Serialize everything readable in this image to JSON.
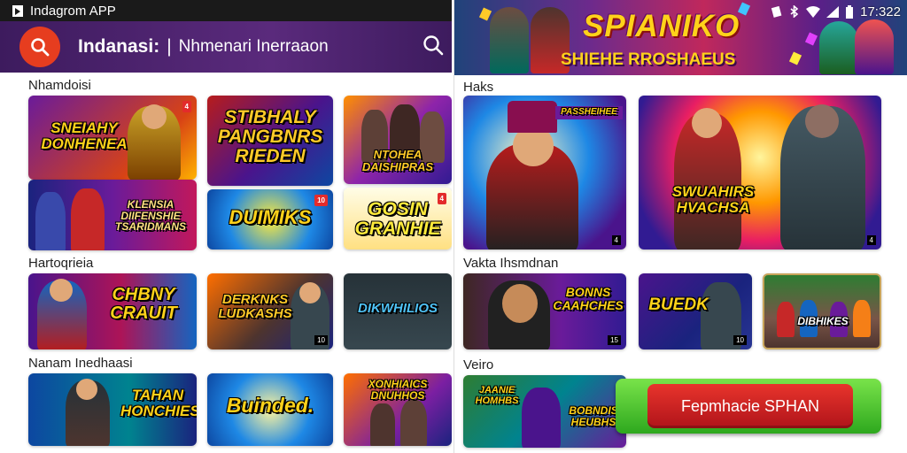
{
  "app": {
    "title": "Indagrom APP"
  },
  "search": {
    "title": "Indanasi:",
    "separator": "|",
    "subtitle": "Nhmenari Inerraaon"
  },
  "hero": {
    "title": "SPIANIKO",
    "subtitle": "SHIEHE RROSHAEUS"
  },
  "status": {
    "time": "17:322"
  },
  "left": {
    "sections": [
      {
        "title": "Nhamdoisi"
      },
      {
        "title": "Hartoqrieia"
      },
      {
        "title": "Nanam Inedhaasi"
      }
    ],
    "cards": [
      {
        "text": "SNEIAHY DONHENEA",
        "badge": "4"
      },
      {
        "text": "KLENSIA DIIFENSHIE TSARIDMANS",
        "badge": ""
      },
      {
        "text": "STIBHALY PANGBNRS RIEDEN",
        "badge": ""
      },
      {
        "text": "DUIMIKS",
        "badge": "10"
      },
      {
        "text": "NTOHEA DAISHIPRAS",
        "badge": ""
      },
      {
        "text": "GOSIN GRANHIE",
        "badge": "4"
      },
      {
        "text": "CHBNY CRAUIT",
        "badge": ""
      },
      {
        "text": "DERKNKS LUDKASHS",
        "badge": "10"
      },
      {
        "text": "DIKWHILIOS",
        "badge": ""
      },
      {
        "text": "TAHAN HONCHIES",
        "badge": ""
      },
      {
        "text": "Buinded.",
        "badge": ""
      },
      {
        "text": "XONHIAICS DNUHHOS",
        "badge": ""
      }
    ]
  },
  "right": {
    "sections": [
      {
        "title": "Haks"
      },
      {
        "title": "Vakta Ihsmdnan"
      },
      {
        "title": "Veiro"
      }
    ],
    "cards": [
      {
        "text": "PASSHEIHEE",
        "badge": "4"
      },
      {
        "text": "SWUAHIRS HVACHSA",
        "badge": "4"
      },
      {
        "text": "BONNS CAAHCHES",
        "badge": "15"
      },
      {
        "text": "BUEDK",
        "badge": "10"
      },
      {
        "text": "DIBHIKES",
        "badge": ""
      },
      {
        "text": "JAANIE HOMHBS",
        "badge": ""
      },
      {
        "text": "BOBNDIS HEUBHS",
        "badge": ""
      }
    ]
  },
  "spin": {
    "label": "Fepmhacie SPHAN"
  }
}
